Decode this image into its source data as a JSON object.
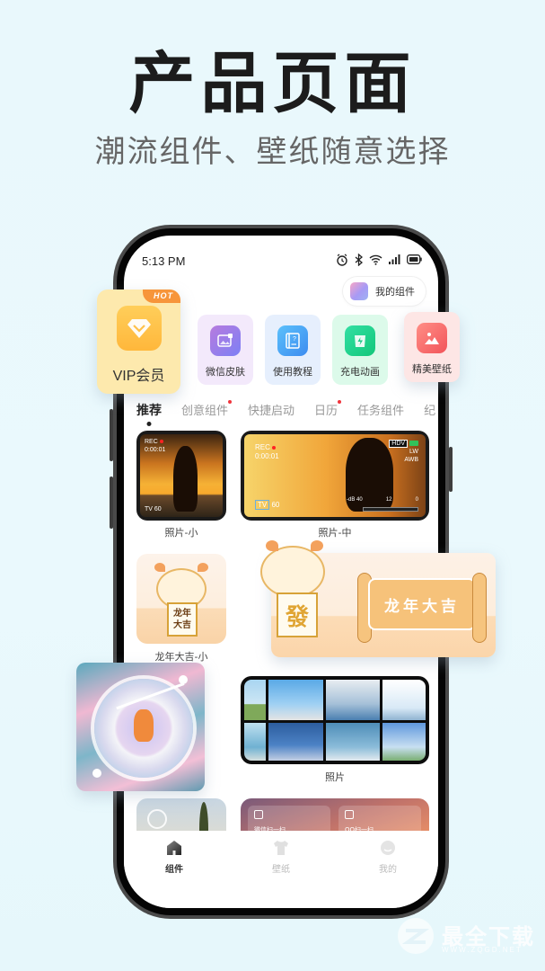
{
  "promo": {
    "headline": "产品页面",
    "subline": "潮流组件、壁纸随意选择"
  },
  "status_bar": {
    "time": "5:13 PM",
    "icons": [
      "alarm-icon",
      "bluetooth-icon",
      "wifi-icon",
      "signal-icon",
      "battery-icon"
    ]
  },
  "header": {
    "my_widgets_label": "我的组件"
  },
  "quick_actions": [
    {
      "label": "VIP会员",
      "icon": "diamond-icon",
      "badge": "HOT",
      "color": "#ffc24a",
      "bg": "#fde9ad"
    },
    {
      "label": "微信皮肤",
      "icon": "skin-icon",
      "color": "#8f7ff2",
      "bg": "#f3e9fb"
    },
    {
      "label": "使用教程",
      "icon": "book-icon",
      "color": "#4ca3f5",
      "bg": "#e6effd"
    },
    {
      "label": "充电动画",
      "icon": "charge-icon",
      "color": "#1fcf8c",
      "bg": "#dcfaea"
    },
    {
      "label": "精美壁纸",
      "icon": "picture-icon",
      "color": "#f56566",
      "bg": "#fde6e5"
    }
  ],
  "tabs": [
    {
      "label": "推荐",
      "active": true,
      "dot": false
    },
    {
      "label": "创意组件",
      "active": false,
      "dot": true
    },
    {
      "label": "快捷启动",
      "active": false,
      "dot": false
    },
    {
      "label": "日历",
      "active": false,
      "dot": true
    },
    {
      "label": "任务组件",
      "active": false,
      "dot": false
    },
    {
      "label": "纪",
      "active": false,
      "dot": false
    }
  ],
  "widgets": {
    "photo_small": {
      "caption": "照片-小",
      "rec": "REC",
      "timecode": "0:00:01",
      "tv": "TV",
      "fps": "60"
    },
    "photo_medium": {
      "caption": "照片-中",
      "rec": "REC",
      "timecode": "0:00:01",
      "hdv": "HDV",
      "lw": "LW",
      "awb": "AWB",
      "tv": "TV",
      "fps": "60",
      "db": "-dB 40",
      "m12": "12",
      "m0": "0"
    },
    "dragon_small": {
      "caption": "龙年大吉-小",
      "box_text": "龙年大吉"
    },
    "dragon_banner": {
      "scroll_text": "龙年大吉",
      "box_text": "發"
    },
    "photo_collage": {
      "caption": "照片"
    },
    "scan": {
      "wechat_scan": "微信扫一扫",
      "qq_scan": "QQ扫一扫"
    }
  },
  "bottom_nav": [
    {
      "label": "组件",
      "icon": "home-icon",
      "active": true
    },
    {
      "label": "壁纸",
      "icon": "shirt-icon",
      "active": false
    },
    {
      "label": "我的",
      "icon": "profile-icon",
      "active": false
    }
  ],
  "watermark": {
    "title": "最全下载",
    "url": "WWW.ZQGD.NET"
  }
}
